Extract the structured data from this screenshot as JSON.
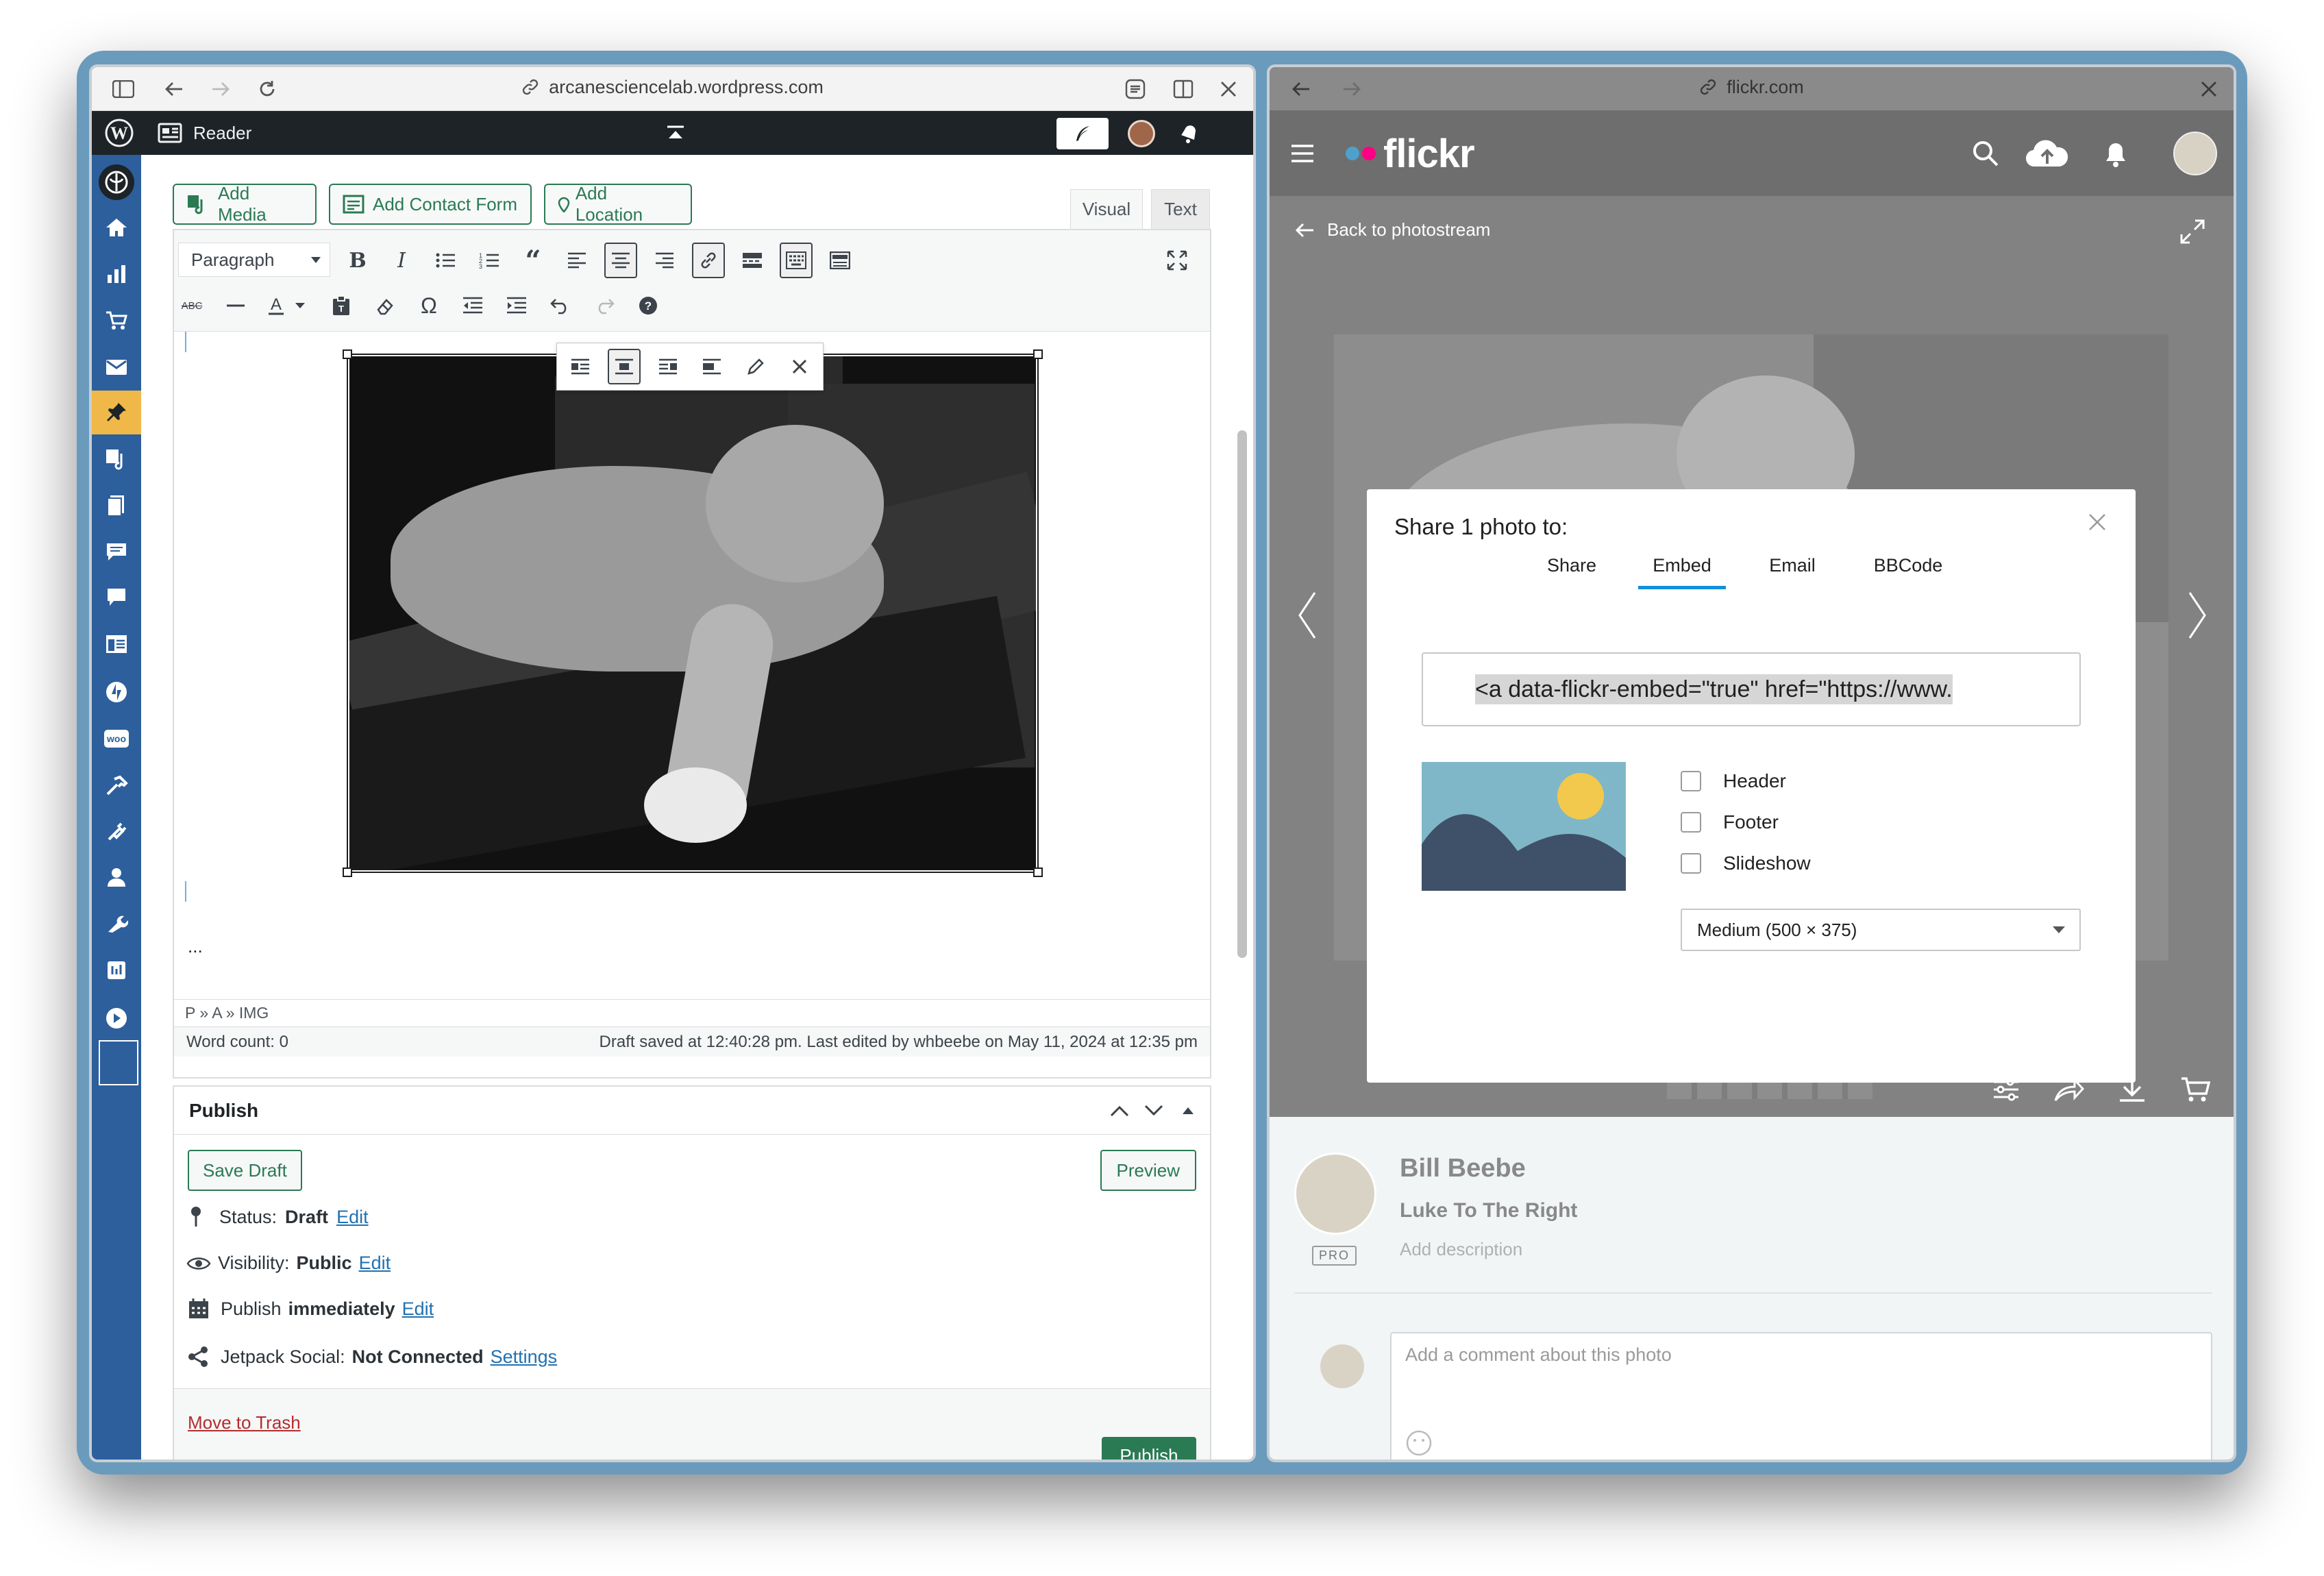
{
  "left_window": {
    "url": "arcanesciencelab.wordpress.com",
    "wp_bar": {
      "reader_label": "Reader"
    },
    "editor": {
      "buttons": {
        "add_media": "Add Media",
        "add_contact_form": "Add Contact Form",
        "add_location": "Add Location"
      },
      "tabs": {
        "visual": "Visual",
        "text": "Text"
      },
      "format_select": "Paragraph",
      "ellipsis": "...",
      "path": "P » A » IMG",
      "word_count": "Word count: 0",
      "draft_status": "Draft saved at 12:40:28 pm. Last edited by whbeebe on May 11, 2024 at 12:35 pm"
    },
    "publish": {
      "title": "Publish",
      "save_draft": "Save Draft",
      "preview": "Preview",
      "status_label": "Status:",
      "status_value": "Draft",
      "status_edit": "Edit",
      "visibility_label": "Visibility:",
      "visibility_value": "Public",
      "visibility_edit": "Edit",
      "publish_label": "Publish",
      "publish_value": "immediately",
      "publish_edit": "Edit",
      "jetpack_label": "Jetpack Social:",
      "jetpack_value": "Not Connected",
      "jetpack_settings": "Settings",
      "trash": "Move to Trash",
      "publish_button": "Publish"
    }
  },
  "right_window": {
    "url": "flickr.com",
    "logo": "flickr",
    "back_label": "Back to photostream",
    "modal": {
      "title": "Share 1 photo to:",
      "tabs": [
        "Share",
        "Embed",
        "Email",
        "BBCode"
      ],
      "active_tab": "Embed",
      "embed_code": "<a data-flickr-embed=\"true\" href=\"https://www.",
      "options": [
        "Header",
        "Footer",
        "Slideshow"
      ],
      "size_select": "Medium (500 × 375)"
    },
    "photo_info": {
      "author": "Bill Beebe",
      "title": "Luke To The Right",
      "description_placeholder": "Add description",
      "pro_badge": "PRO",
      "comment_placeholder": "Add a comment about this photo"
    }
  },
  "colors": {
    "wp_sidebar": "#2c5f9c",
    "wp_green": "#2a7a54",
    "wp_link": "#2271b1",
    "trash_red": "#b32d2e",
    "flickr_blue": "#4fa0cc",
    "flickr_pink": "#ff0084",
    "sun_yellow": "#f2c94c"
  }
}
